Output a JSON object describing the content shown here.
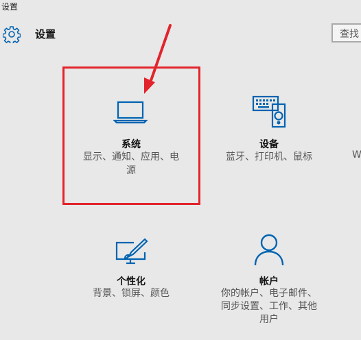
{
  "window": {
    "title": "设置"
  },
  "header": {
    "title": "设置",
    "icon": "gear-icon"
  },
  "search": {
    "label": "查找"
  },
  "tiles": [
    {
      "name": "系统",
      "desc_line1": "显示、通知、应用、电",
      "desc_line2": "源",
      "icon": "laptop-icon"
    },
    {
      "name": "设备",
      "desc_line1": "蓝牙、打印机、鼠标",
      "icon": "keyboard-speaker-icon"
    },
    {
      "name": "个性化",
      "desc_line1": "背景、锁屏、颜色",
      "icon": "paint-monitor-icon"
    },
    {
      "name": "帐户",
      "desc_line1": "你的帐户、电子邮件、",
      "desc_line2": "同步设置、工作、其他",
      "desc_line3": "用户",
      "icon": "person-icon"
    }
  ],
  "partial_tile": {
    "text": "W"
  },
  "colors": {
    "accent": "#0063b1",
    "annotation": "#e2242c",
    "background": "#e8e8e8"
  }
}
